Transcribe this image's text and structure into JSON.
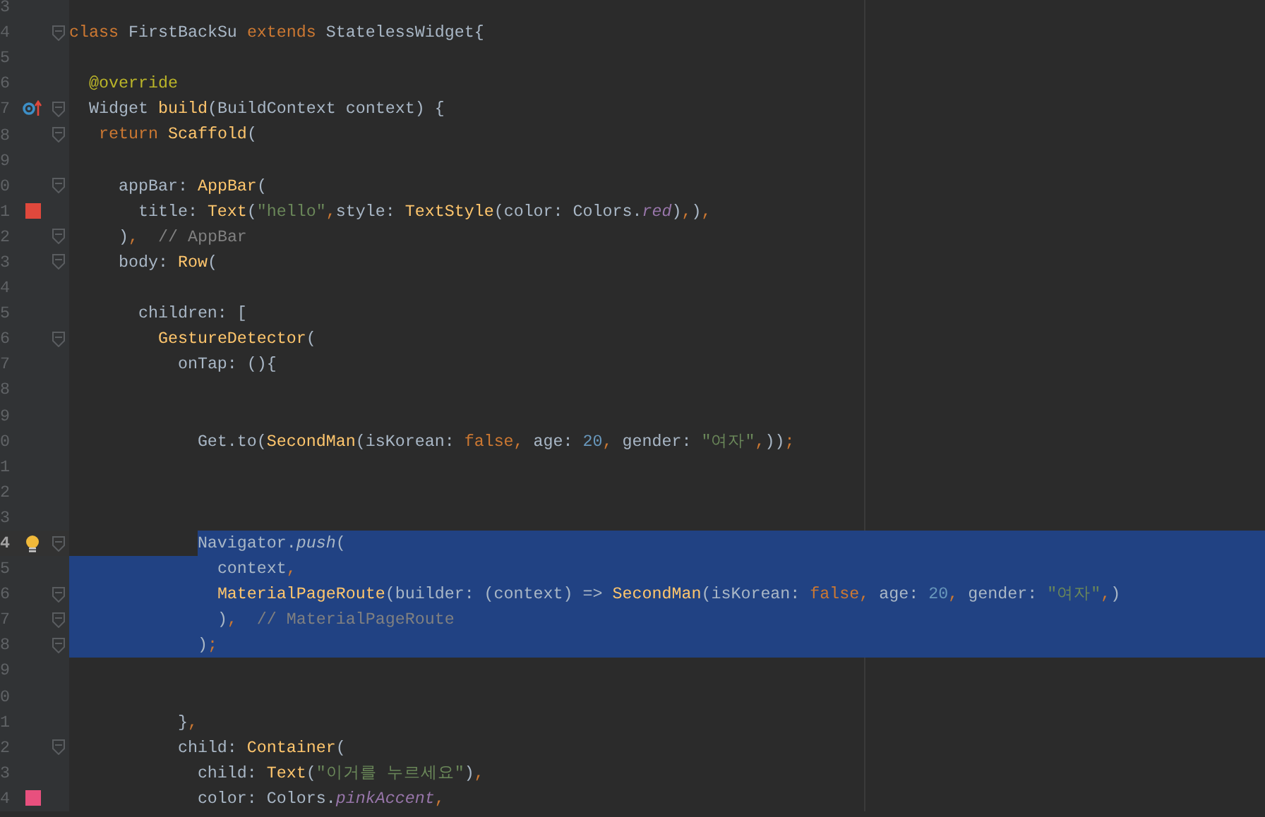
{
  "editor": {
    "lines": [
      {
        "number": "3",
        "selected": false
      },
      {
        "number": "4",
        "selected": false,
        "fold": true,
        "tokens": [
          {
            "kind": "keyword",
            "text": "class "
          },
          {
            "kind": "plain",
            "text": "FirstBackSu "
          },
          {
            "kind": "keyword",
            "text": "extends "
          },
          {
            "kind": "plain",
            "text": "StatelessWidget{"
          }
        ]
      },
      {
        "number": "5",
        "selected": false
      },
      {
        "number": "6",
        "selected": false,
        "tokens": [
          {
            "kind": "annotation",
            "text": "  @override"
          }
        ]
      },
      {
        "number": "7",
        "selected": false,
        "fold": true,
        "marker": {
          "kind": "override"
        },
        "tokens": [
          {
            "kind": "plain",
            "text": "  Widget "
          },
          {
            "kind": "function",
            "text": "build"
          },
          {
            "kind": "plain",
            "text": "(BuildContext context) {"
          }
        ]
      },
      {
        "number": "8",
        "selected": false,
        "fold": true,
        "tokens": [
          {
            "kind": "keyword",
            "text": "   return "
          },
          {
            "kind": "class",
            "text": "Scaffold"
          },
          {
            "kind": "plain",
            "text": "("
          }
        ]
      },
      {
        "number": "9",
        "selected": false
      },
      {
        "number": "0",
        "selected": false,
        "fold": true,
        "tokens": [
          {
            "kind": "plain",
            "text": "     appBar: "
          },
          {
            "kind": "class",
            "text": "AppBar"
          },
          {
            "kind": "plain",
            "text": "("
          }
        ]
      },
      {
        "number": "1",
        "selected": false,
        "marker": {
          "kind": "swatch",
          "color": "#e0483c"
        },
        "tokens": [
          {
            "kind": "plain",
            "text": "       title: "
          },
          {
            "kind": "class",
            "text": "Text"
          },
          {
            "kind": "plain",
            "text": "("
          },
          {
            "kind": "string",
            "text": "\"hello\""
          },
          {
            "kind": "keyword",
            "text": ","
          },
          {
            "kind": "plain",
            "text": "style: "
          },
          {
            "kind": "class",
            "text": "TextStyle"
          },
          {
            "kind": "plain",
            "text": "(color: Colors."
          },
          {
            "kind": "field",
            "text": "red"
          },
          {
            "kind": "plain",
            "text": ")"
          },
          {
            "kind": "keyword",
            "text": ","
          },
          {
            "kind": "plain",
            "text": ")"
          },
          {
            "kind": "keyword",
            "text": ","
          }
        ]
      },
      {
        "number": "2",
        "selected": false,
        "fold": true,
        "tokens": [
          {
            "kind": "plain",
            "text": "     )"
          },
          {
            "kind": "keyword",
            "text": ","
          },
          {
            "kind": "comment",
            "text": "  // AppBar"
          }
        ]
      },
      {
        "number": "3",
        "selected": false,
        "fold": true,
        "tokens": [
          {
            "kind": "plain",
            "text": "     body: "
          },
          {
            "kind": "class",
            "text": "Row"
          },
          {
            "kind": "plain",
            "text": "("
          }
        ]
      },
      {
        "number": "4",
        "selected": false
      },
      {
        "number": "5",
        "selected": false,
        "tokens": [
          {
            "kind": "plain",
            "text": "       children: ["
          }
        ]
      },
      {
        "number": "6",
        "selected": false,
        "fold": true,
        "tokens": [
          {
            "kind": "class",
            "text": "         GestureDetector"
          },
          {
            "kind": "plain",
            "text": "("
          }
        ]
      },
      {
        "number": "7",
        "selected": false,
        "tokens": [
          {
            "kind": "plain",
            "text": "           onTap: (){"
          }
        ]
      },
      {
        "number": "8",
        "selected": false
      },
      {
        "number": "9",
        "selected": false
      },
      {
        "number": "0",
        "selected": false,
        "tokens": [
          {
            "kind": "plain",
            "text": "             Get.to("
          },
          {
            "kind": "class",
            "text": "SecondMan"
          },
          {
            "kind": "plain",
            "text": "(isKorean: "
          },
          {
            "kind": "keyword",
            "text": "false, "
          },
          {
            "kind": "plain",
            "text": "age: "
          },
          {
            "kind": "number",
            "text": "20"
          },
          {
            "kind": "keyword",
            "text": ", "
          },
          {
            "kind": "plain",
            "text": "gender: "
          },
          {
            "kind": "string",
            "text": "\"여자\""
          },
          {
            "kind": "keyword",
            "text": ","
          },
          {
            "kind": "plain",
            "text": "))"
          },
          {
            "kind": "keyword",
            "text": ";"
          }
        ]
      },
      {
        "number": "1",
        "selected": false
      },
      {
        "number": "2",
        "selected": false
      },
      {
        "number": "3",
        "selected": false
      },
      {
        "number": "4",
        "current": true,
        "selected": true,
        "fold": true,
        "marker": {
          "kind": "bulb"
        },
        "tokens": [
          {
            "kind": "plain",
            "text": "             Navigator."
          },
          {
            "kind": "method",
            "text": "push"
          },
          {
            "kind": "plain",
            "text": "("
          }
        ]
      },
      {
        "number": "5",
        "selected": true,
        "tokens": [
          {
            "kind": "plain",
            "text": "               context"
          },
          {
            "kind": "keyword",
            "text": ","
          }
        ]
      },
      {
        "number": "6",
        "selected": true,
        "fold": true,
        "tokens": [
          {
            "kind": "class",
            "text": "               MaterialPageRoute"
          },
          {
            "kind": "plain",
            "text": "(builder: (context) => "
          },
          {
            "kind": "class",
            "text": "SecondMan"
          },
          {
            "kind": "plain",
            "text": "(isKorean: "
          },
          {
            "kind": "keyword",
            "text": "false, "
          },
          {
            "kind": "plain",
            "text": "age: "
          },
          {
            "kind": "number",
            "text": "20"
          },
          {
            "kind": "keyword",
            "text": ", "
          },
          {
            "kind": "plain",
            "text": "gender: "
          },
          {
            "kind": "string",
            "text": "\"여자\""
          },
          {
            "kind": "keyword",
            "text": ","
          },
          {
            "kind": "plain",
            "text": ")"
          }
        ]
      },
      {
        "number": "7",
        "selected": true,
        "fold": true,
        "tokens": [
          {
            "kind": "plain",
            "text": "               )"
          },
          {
            "kind": "keyword",
            "text": ","
          },
          {
            "kind": "comment",
            "text": "  // MaterialPageRoute"
          }
        ]
      },
      {
        "number": "8",
        "selected": true,
        "fold": true,
        "tokens": [
          {
            "kind": "plain",
            "text": "             )"
          },
          {
            "kind": "keyword",
            "text": ";"
          }
        ]
      },
      {
        "number": "9",
        "selected": false
      },
      {
        "number": "0",
        "selected": false
      },
      {
        "number": "1",
        "selected": false,
        "tokens": [
          {
            "kind": "plain",
            "text": "           }"
          },
          {
            "kind": "keyword",
            "text": ","
          }
        ]
      },
      {
        "number": "2",
        "selected": false,
        "fold": true,
        "tokens": [
          {
            "kind": "plain",
            "text": "           child: "
          },
          {
            "kind": "class",
            "text": "Container"
          },
          {
            "kind": "plain",
            "text": "("
          }
        ]
      },
      {
        "number": "3",
        "selected": false,
        "tokens": [
          {
            "kind": "plain",
            "text": "             child: "
          },
          {
            "kind": "class",
            "text": "Text"
          },
          {
            "kind": "plain",
            "text": "("
          },
          {
            "kind": "string",
            "text": "\"이거를 누르세요\""
          },
          {
            "kind": "plain",
            "text": ")"
          },
          {
            "kind": "keyword",
            "text": ","
          }
        ]
      },
      {
        "number": "4",
        "selected": false,
        "marker": {
          "kind": "swatch",
          "color": "#e8507e"
        },
        "tokens": [
          {
            "kind": "plain",
            "text": "             color: Colors."
          },
          {
            "kind": "field",
            "text": "pinkAccent"
          },
          {
            "kind": "keyword",
            "text": ","
          }
        ]
      }
    ]
  }
}
